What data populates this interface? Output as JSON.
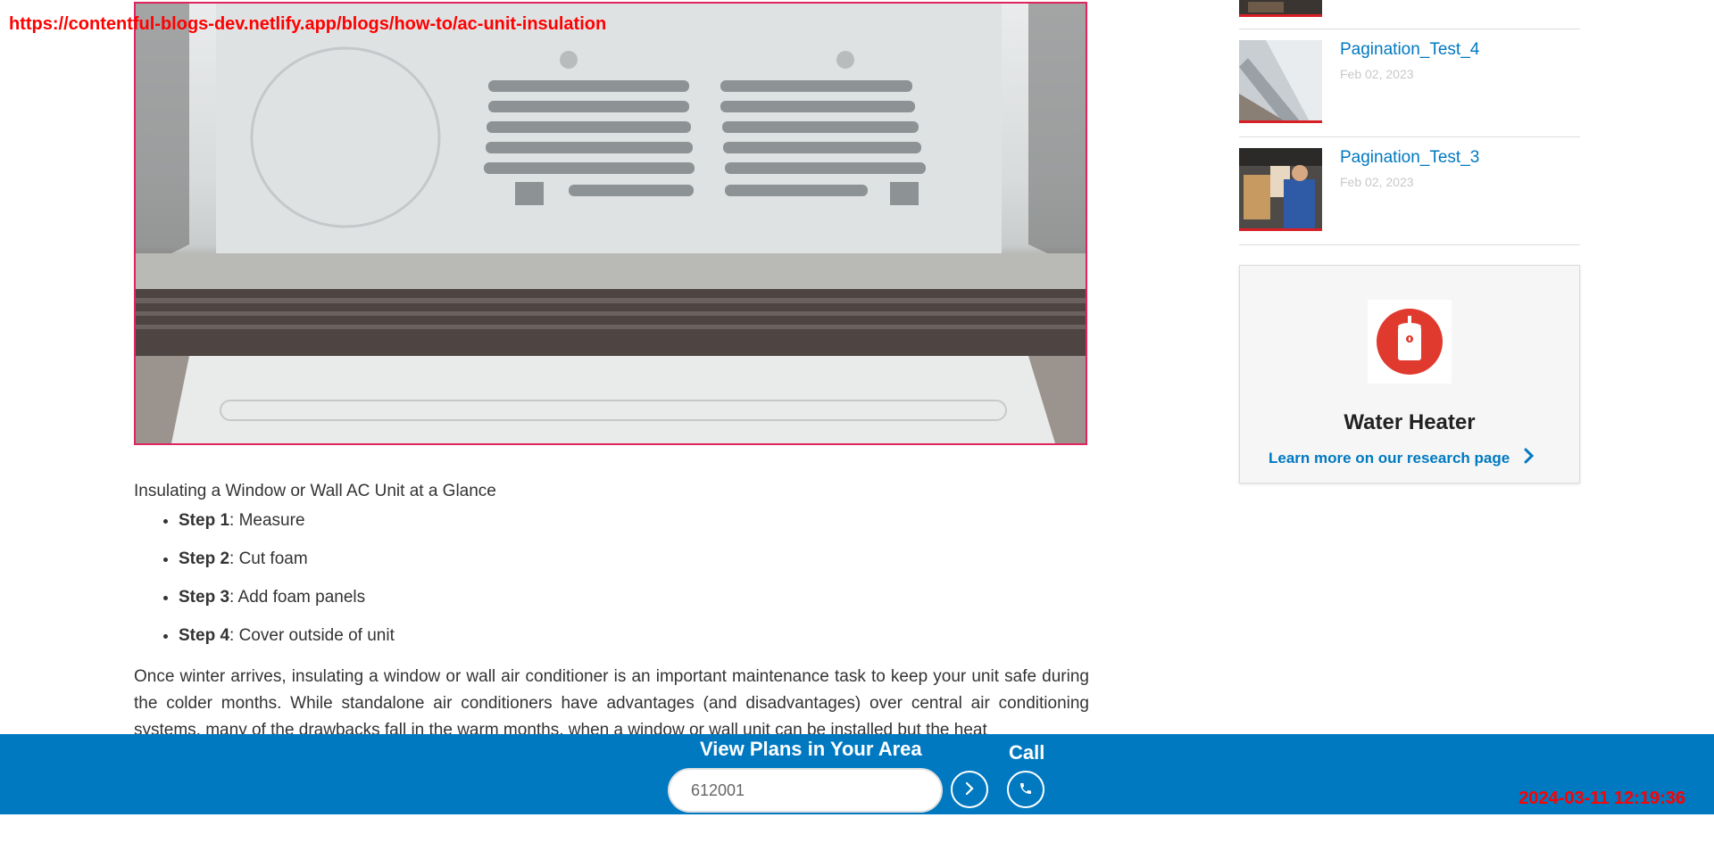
{
  "overlay": {
    "url": "https://contentful-blogs-dev.netlify.app/blogs/how-to/ac-unit-insulation",
    "timestamp": "2024-03-11 12:19:36"
  },
  "article": {
    "heading": "Insulating a Window or Wall AC Unit at a Glance",
    "steps": [
      {
        "label": "Step 1",
        "text": ": Measure"
      },
      {
        "label": "Step 2",
        "text": ": Cut foam"
      },
      {
        "label": "Step 3",
        "text": ": Add foam panels"
      },
      {
        "label": "Step 4",
        "text": ": Cover outside of unit"
      }
    ],
    "paragraph": "Once winter arrives, insulating a window or wall air conditioner is an important maintenance task to keep your unit safe during the colder months. While standalone air conditioners have advantages (and disadvantages) over central air conditioning systems, many of the drawbacks fall in the warm months, when a window or wall unit can be installed but the heat"
  },
  "sidebar": {
    "posts": [
      {
        "title": "Pagination_Test_4",
        "date": "Feb 02, 2023"
      },
      {
        "title": "Pagination_Test_3",
        "date": "Feb 02, 2023"
      }
    ],
    "promo": {
      "title": "Water Heater",
      "link": "Learn more on our research page",
      "icon": "water-heater-icon"
    }
  },
  "bottom_bar": {
    "title": "View Plans in Your Area",
    "zip_value": "612001",
    "call_label": "Call",
    "go_icon": "chevron-right-icon",
    "call_icon": "phone-icon"
  },
  "colors": {
    "brand_blue": "#0079c1",
    "accent_red": "#e03a2f",
    "overlay_red": "#ff0000"
  }
}
